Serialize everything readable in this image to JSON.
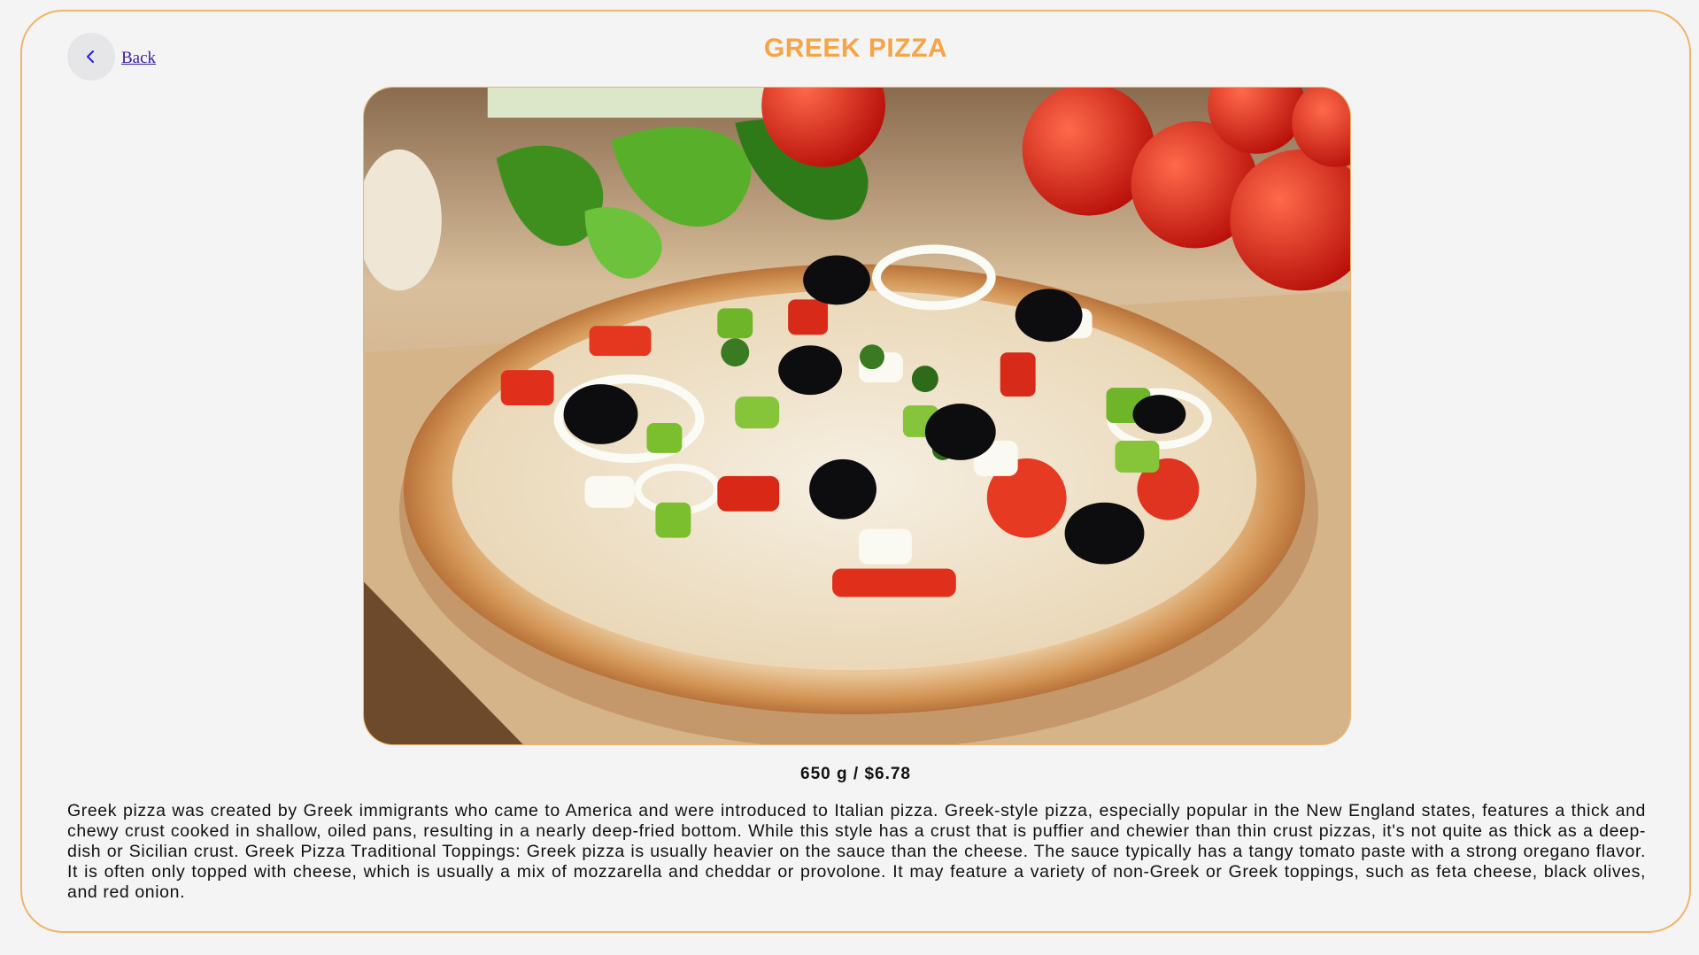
{
  "nav": {
    "back_icon": "chevron-left-icon",
    "back_label": "Back"
  },
  "product": {
    "title": "GREEK PIZZA",
    "image_subject": "greek-pizza-photo",
    "price_line": "650 g / $6.78",
    "description": "Greek pizza was created by Greek immigrants who came to America and were introduced to Italian pizza. Greek-style pizza, especially popular in the New England states, features a thick and chewy crust cooked in shallow, oiled pans, resulting in a nearly deep-fried bottom. While this style has a crust that is puffier and chewier than thin crust pizzas, it's not quite as thick as a deep-dish or Sicilian crust. Greek Pizza Traditional Toppings: Greek pizza is usually heavier on the sauce than the cheese. The sauce typically has a tangy tomato paste with a strong oregano flavor. It is often only topped with cheese, which is usually a mix of mozzarella and cheddar or provolone. It may feature a variety of non-Greek or Greek toppings, such as feta cheese, black olives, and red onion."
  },
  "colors": {
    "accent": "#f5a545",
    "border": "#efb56a",
    "background": "#f4f4f4",
    "link": "#3a1aa0"
  }
}
